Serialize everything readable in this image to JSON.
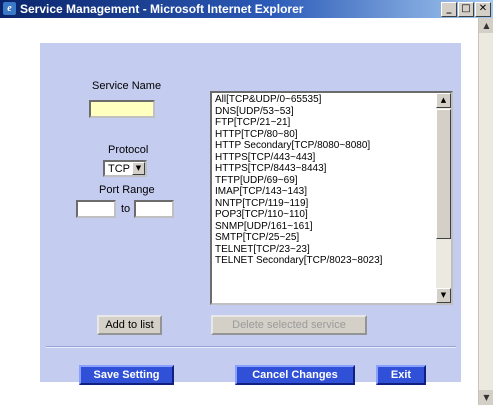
{
  "window": {
    "title": "Service Management - Microsoft Internet Explorer",
    "minimize": "_",
    "maximize": "□",
    "close": "✕"
  },
  "form": {
    "service_name_label": "Service Name",
    "service_name_value": "",
    "protocol_label": "Protocol",
    "protocol_value": "TCP",
    "port_range_label": "Port Range",
    "port_from_value": "",
    "to_label": "to",
    "port_to_value": ""
  },
  "services": [
    "All[TCP&UDP/0~65535]",
    "DNS[UDP/53~53]",
    "FTP[TCP/21~21]",
    "HTTP[TCP/80~80]",
    "HTTP Secondary[TCP/8080~8080]",
    "HTTPS[TCP/443~443]",
    "HTTPS[TCP/8443~8443]",
    "TFTP[UDP/69~69]",
    "IMAP[TCP/143~143]",
    "NNTP[TCP/119~119]",
    "POP3[TCP/110~110]",
    "SNMP[UDP/161~161]",
    "SMTP[TCP/25~25]",
    "TELNET[TCP/23~23]",
    "TELNET Secondary[TCP/8023~8023]"
  ],
  "buttons": {
    "add_to_list": "Add to list",
    "delete_selected": "Delete selected service",
    "save_setting": "Save Setting",
    "cancel_changes": "Cancel Changes",
    "exit": "Exit"
  },
  "colors": {
    "panel": "#c4ccf0",
    "service_name_field": "#ffffc0",
    "primary_button": "#3050d8",
    "titlebar": "#0a246a"
  },
  "icons": {
    "app": "ie-icon",
    "dropdown": "chevron-down-icon",
    "scroll_up": "arrow-up-icon",
    "scroll_down": "arrow-down-icon"
  }
}
